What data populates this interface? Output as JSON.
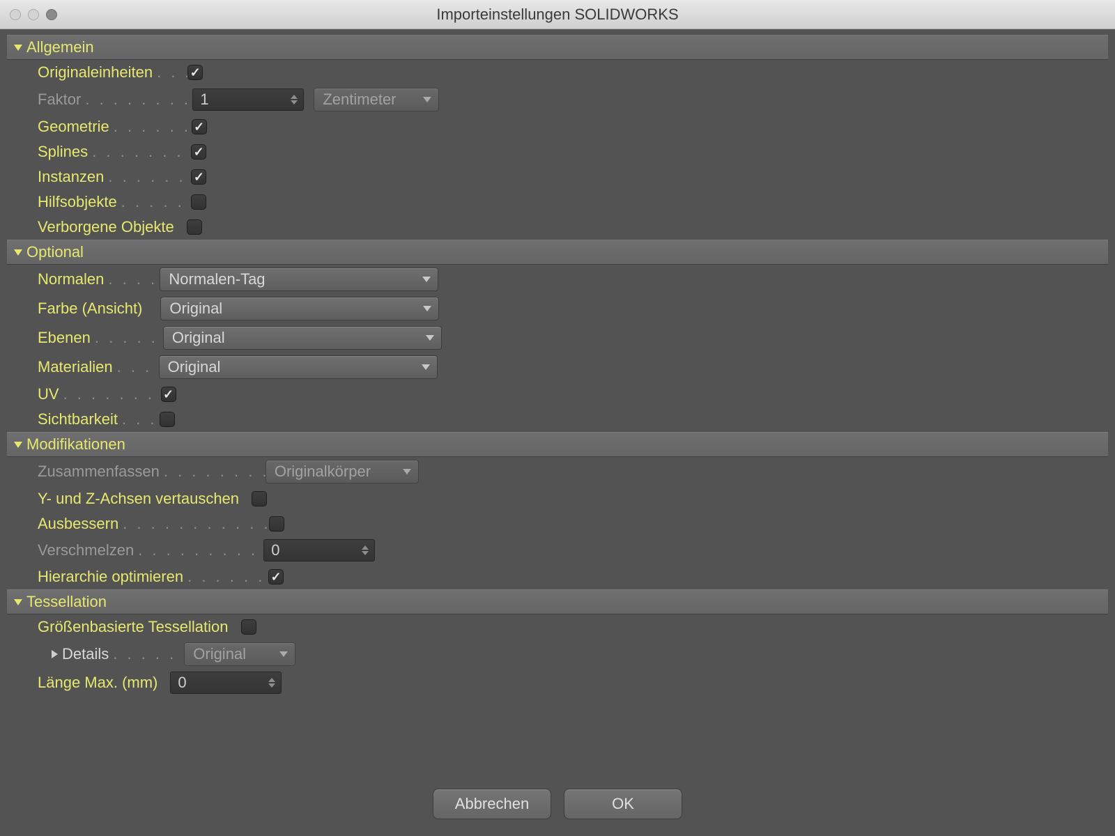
{
  "window": {
    "title": "Importeinstellungen SOLIDWORKS"
  },
  "sections": {
    "allgemein": {
      "title": "Allgemein",
      "originaleinheiten": {
        "label": "Originaleinheiten",
        "checked": true
      },
      "faktor": {
        "label": "Faktor",
        "value": "1",
        "unit": "Zentimeter",
        "disabled": true
      },
      "geometrie": {
        "label": "Geometrie",
        "checked": true
      },
      "splines": {
        "label": "Splines",
        "checked": true
      },
      "instanzen": {
        "label": "Instanzen",
        "checked": true
      },
      "hilfsobjekte": {
        "label": "Hilfsobjekte",
        "checked": false
      },
      "verborgene": {
        "label": "Verborgene Objekte",
        "checked": false
      }
    },
    "optional": {
      "title": "Optional",
      "normalen": {
        "label": "Normalen",
        "value": "Normalen-Tag"
      },
      "farbe": {
        "label": "Farbe (Ansicht)",
        "value": "Original"
      },
      "ebenen": {
        "label": "Ebenen",
        "value": "Original"
      },
      "materialien": {
        "label": "Materialien",
        "value": "Original"
      },
      "uv": {
        "label": "UV",
        "checked": true
      },
      "sichtbarkeit": {
        "label": "Sichtbarkeit",
        "checked": false
      }
    },
    "modifikationen": {
      "title": "Modifikationen",
      "zusammenfassen": {
        "label": "Zusammenfassen",
        "value": "Originalkörper",
        "disabled": true
      },
      "yz": {
        "label": "Y- und Z-Achsen vertauschen",
        "checked": false
      },
      "ausbessern": {
        "label": "Ausbessern",
        "checked": false
      },
      "verschmelzen": {
        "label": "Verschmelzen",
        "value": "0",
        "disabled": true
      },
      "hierarchie": {
        "label": "Hierarchie optimieren",
        "checked": true
      }
    },
    "tessellation": {
      "title": "Tessellation",
      "groessen": {
        "label": "Größenbasierte Tessellation",
        "checked": false
      },
      "details": {
        "label": "Details",
        "value": "Original",
        "disabled": true
      },
      "laenge": {
        "label": "Länge Max. (mm)",
        "value": "0"
      }
    }
  },
  "buttons": {
    "cancel": "Abbrechen",
    "ok": "OK"
  }
}
